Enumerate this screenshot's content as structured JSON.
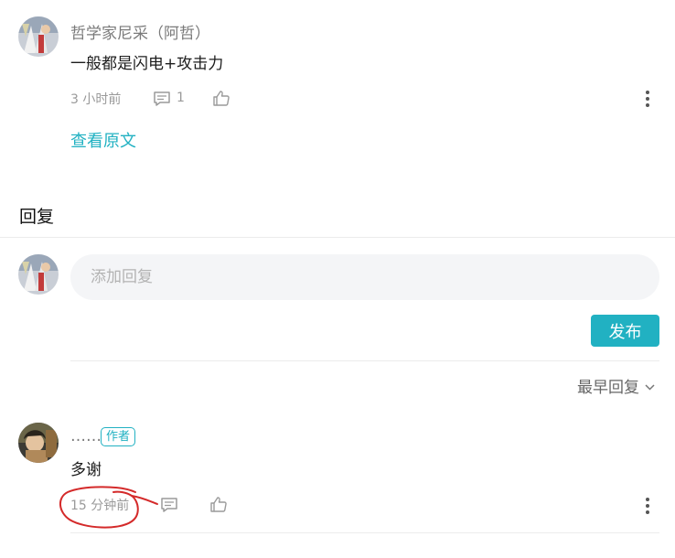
{
  "top_comment": {
    "author": "哲学家尼采（阿哲）",
    "text": "一般都是闪电+攻击力",
    "time": "3 小时前",
    "reply_count": "1",
    "view_original": "查看原文"
  },
  "reply_section": {
    "title": "回复",
    "input_placeholder": "添加回复",
    "publish_label": "发布",
    "sort_label": "最早回复"
  },
  "reply": {
    "author": "……",
    "badge": "作者",
    "text": "多谢",
    "time": "15 分钟前"
  },
  "icons": {
    "comment": "comment-icon",
    "like": "thumbs-up-icon",
    "more": "more-vertical-icon",
    "chevron": "chevron-down-icon"
  },
  "colors": {
    "accent": "#21b1c2",
    "annotation": "#d42a2a"
  }
}
